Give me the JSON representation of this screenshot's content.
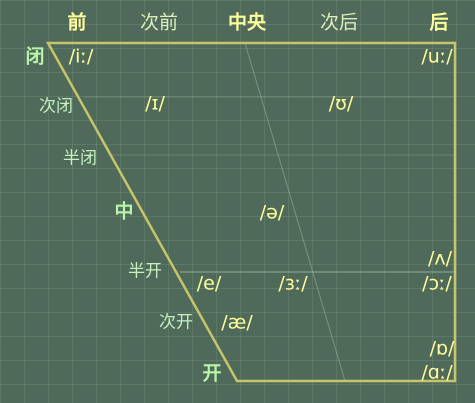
{
  "header": {
    "front": "前",
    "near_front": "次前",
    "central": "中央",
    "near_back": "次后",
    "back": "后"
  },
  "heights": {
    "close": "闭",
    "near_close": "次闭",
    "close_mid": "半闭",
    "mid": "中",
    "open_mid": "半开",
    "near_open": "次开",
    "open": "开"
  },
  "vowels": {
    "i_long": "/iː/",
    "u_long": "/uː/",
    "near_close_front": "/ɪ/",
    "near_close_back": "/ʊ/",
    "schwa": "/ə/",
    "wedge": "/ʌ/",
    "e": "/e/",
    "er_long": "/ɜː/",
    "open_o_long": "/ɔː/",
    "ash": "/æ/",
    "open_o_short": "/ɒ/",
    "a_long": "/ɑː/"
  },
  "colors": {
    "background": "#4f6a5a",
    "frame": "#c8c46a",
    "grid_line": "#9bb89a",
    "text_bright": "#ffff9a",
    "text_soft": "#dcefb8",
    "text_label": "#c6f0c0",
    "text_bold": "#b8f5a8"
  }
}
